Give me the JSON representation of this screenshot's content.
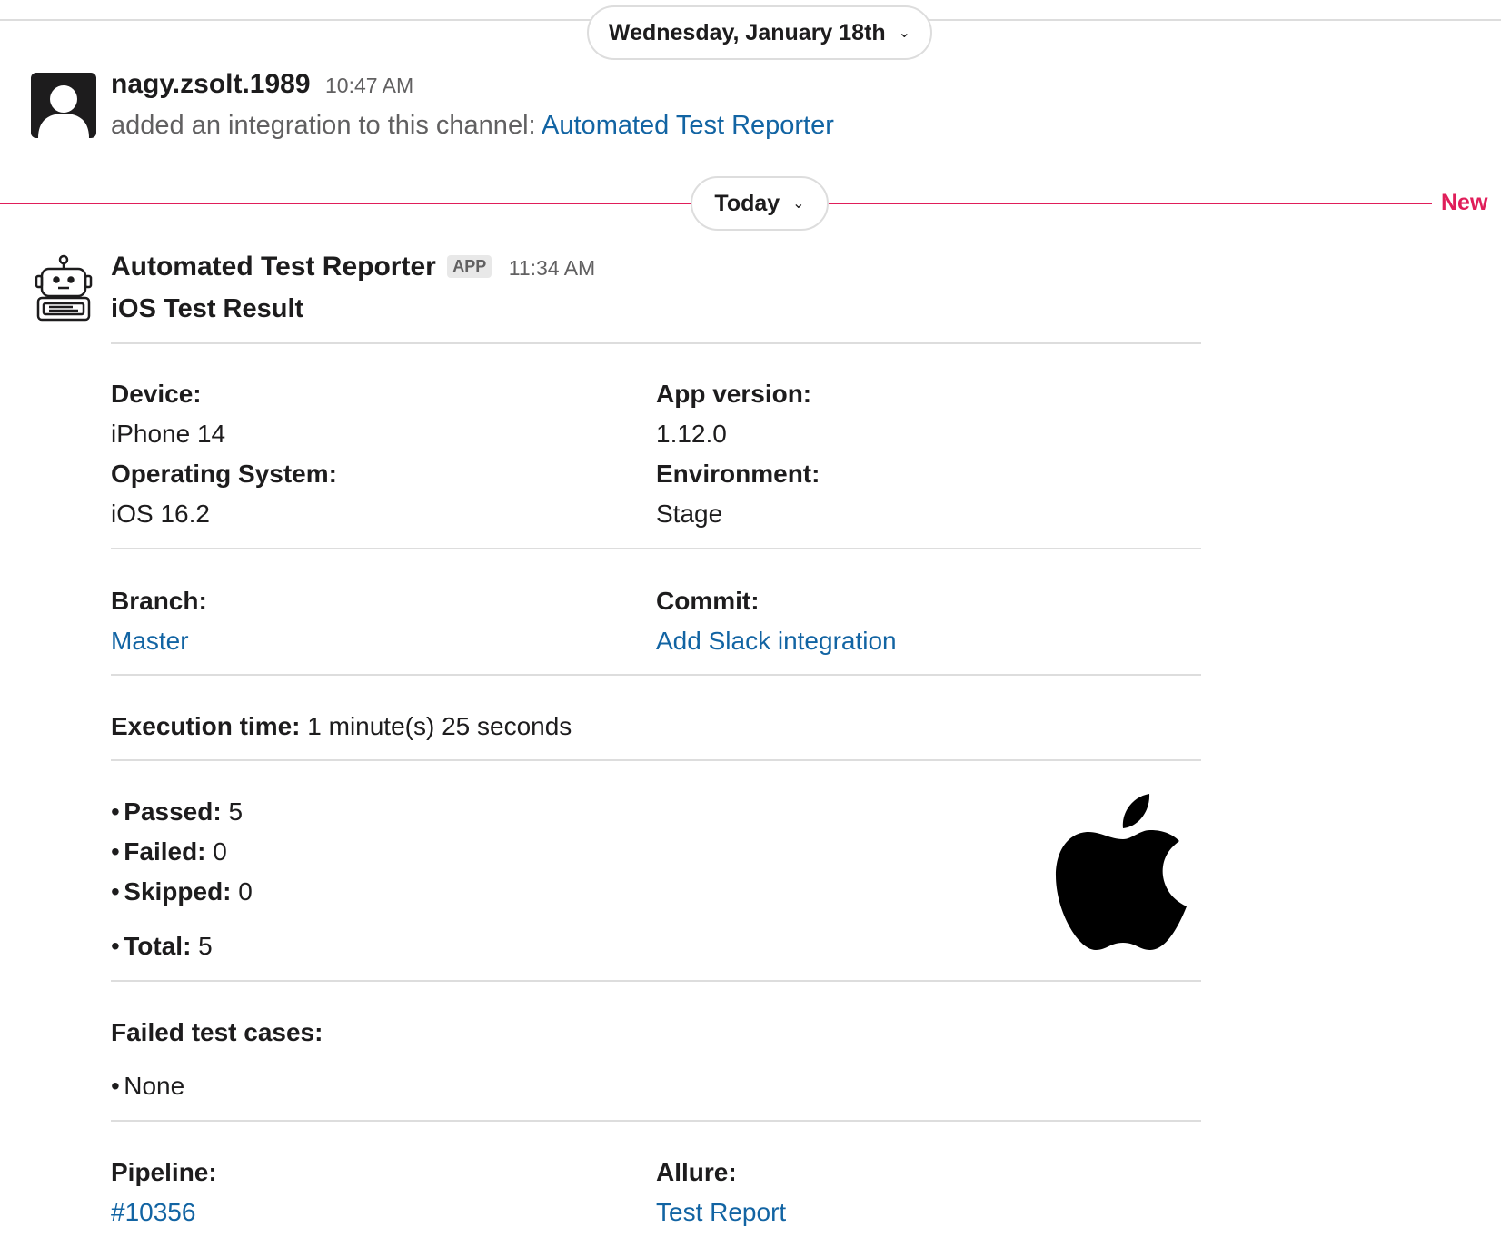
{
  "dividers": {
    "date_label": "Wednesday, January 18th",
    "today_label": "Today",
    "new_label": "New"
  },
  "colors": {
    "link": "#1264a3",
    "new_divider": "#e01e5a"
  },
  "message1": {
    "author": "nagy.zsolt.1989",
    "time": "10:47 AM",
    "text": "added an integration to this channel: ",
    "link_text": "Automated Test Reporter",
    "avatar_icon": "user-silhouette-icon"
  },
  "message2": {
    "author": "Automated Test Reporter",
    "badge": "APP",
    "time": "11:34 AM",
    "title": "iOS Test Result",
    "avatar_icon": "robot-icon",
    "fields": {
      "device_label": "Device:",
      "device_value": "iPhone 14",
      "app_version_label": "App version:",
      "app_version_value": "1.12.0",
      "os_label": "Operating System:",
      "os_value": "iOS 16.2",
      "environment_label": "Environment:",
      "environment_value": "Stage",
      "branch_label": "Branch:",
      "branch_value": "Master",
      "commit_label": "Commit:",
      "commit_value": "Add Slack integration",
      "execution_label": "Execution time:",
      "execution_value": " 1 minute(s) 25 seconds"
    },
    "results": {
      "bullet": "•",
      "passed_label": "Passed:",
      "passed_value": " 5",
      "failed_label": "Failed:",
      "failed_value": " 0",
      "skipped_label": "Skipped:",
      "skipped_value": " 0",
      "total_label": "Total:",
      "total_value": " 5",
      "logo_icon": "apple-logo-icon"
    },
    "failed_cases": {
      "label": "Failed test cases:",
      "items": [
        "None"
      ]
    },
    "links": {
      "pipeline_label": "Pipeline:",
      "pipeline_value": "#10356",
      "allure_label": "Allure:",
      "allure_value": "Test Report"
    }
  }
}
